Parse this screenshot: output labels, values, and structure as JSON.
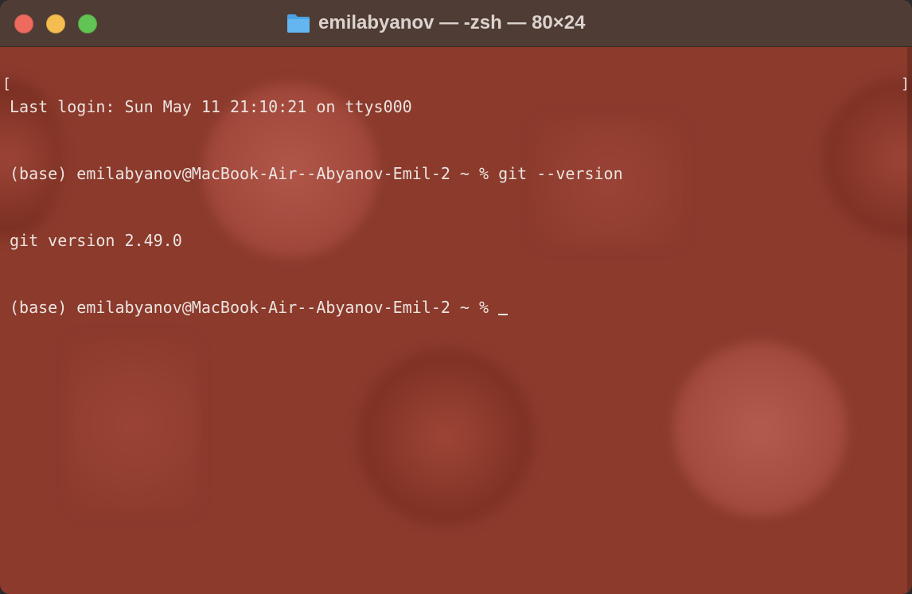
{
  "window": {
    "title": "emilabyanov — -zsh — 80×24",
    "traffic_lights": [
      "close",
      "minimize",
      "zoom"
    ],
    "title_icon": "folder-icon",
    "colors": {
      "titlebar": "#4e3c35",
      "background": "#8b3a2c",
      "text": "#ece4e0",
      "close": "#ee6a5e",
      "minimize": "#f5bd4f",
      "zoom": "#61c454"
    }
  },
  "terminal": {
    "lines": [
      "Last login: Sun May 11 21:10:21 on ttys000",
      "(base) emilabyanov@MacBook-Air--Abyanov-Emil-2 ~ % git --version",
      "git version 2.49.0",
      "(base) emilabyanov@MacBook-Air--Abyanov-Emil-2 ~ % "
    ],
    "left_marker": "[",
    "right_marker": "]"
  }
}
